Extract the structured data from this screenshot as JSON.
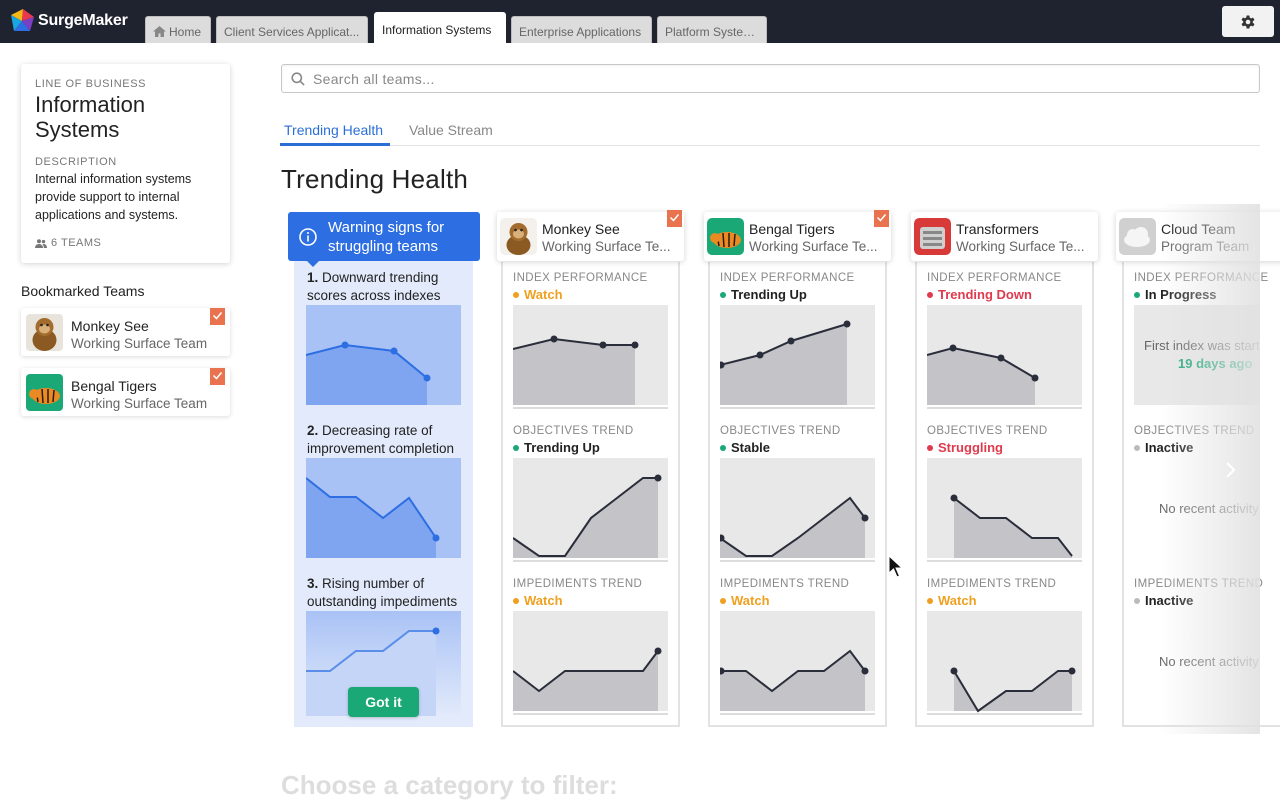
{
  "app": {
    "name": "SurgeMaker"
  },
  "tabs": [
    {
      "label": "Home"
    },
    {
      "label": "Client Services Applicat..."
    },
    {
      "label": "Information Systems"
    },
    {
      "label": "Enterprise Applications"
    },
    {
      "label": "Platform Systems"
    }
  ],
  "lob": {
    "caption": "LINE OF BUSINESS",
    "title": "Information Systems",
    "desc_caption": "DESCRIPTION",
    "description": "Internal information systems provide support to internal applications and systems.",
    "teams": "6 TEAMS"
  },
  "bookmarks": {
    "heading": "Bookmarked Teams",
    "items": [
      {
        "name": "Monkey See",
        "type": "Working Surface Team"
      },
      {
        "name": "Bengal Tigers",
        "type": "Working Surface Team"
      }
    ]
  },
  "search": {
    "placeholder": "Search all teams..."
  },
  "subtabs": [
    {
      "label": "Trending Health"
    },
    {
      "label": "Value Stream"
    }
  ],
  "page_title": "Trending Health",
  "warning": {
    "title": "Warning signs for struggling teams",
    "items": [
      {
        "num": "1.",
        "text": "Downward trending scores across indexes"
      },
      {
        "num": "2.",
        "text": "Decreasing rate of improvement completion"
      },
      {
        "num": "3.",
        "text": "Rising number of outstanding impediments"
      }
    ],
    "button": "Got it"
  },
  "section_labels": {
    "index": "INDEX PERFORMANCE",
    "objectives": "OBJECTIVES TREND",
    "impediments": "IMPEDIMENTS TREND"
  },
  "colors": {
    "watch": "#f0a020",
    "up": "#1aa876",
    "down": "#e03a4e",
    "inactive": "#bbbbbb",
    "accent": "#2b6fd6"
  },
  "teams": [
    {
      "name": "Monkey See",
      "type": "Working Surface Te...",
      "index": "Watch",
      "objectives": "Trending Up",
      "impediments": "Watch"
    },
    {
      "name": "Bengal Tigers",
      "type": "Working Surface Te...",
      "index": "Trending Up",
      "objectives": "Stable",
      "impediments": "Watch"
    },
    {
      "name": "Transformers",
      "type": "Working Surface Te...",
      "index": "Trending Down",
      "objectives": "Struggling",
      "impediments": "Watch"
    },
    {
      "name": "Cloud Team",
      "type": "Program Team",
      "index": "In Progress",
      "index_note": "First index was start",
      "index_note2": "19 days ago",
      "objectives": "Inactive",
      "objectives_note": "No recent activity",
      "impediments": "Inactive",
      "impediments_note": "No recent activity"
    }
  ],
  "filter_heading": "Choose a category to filter:"
}
